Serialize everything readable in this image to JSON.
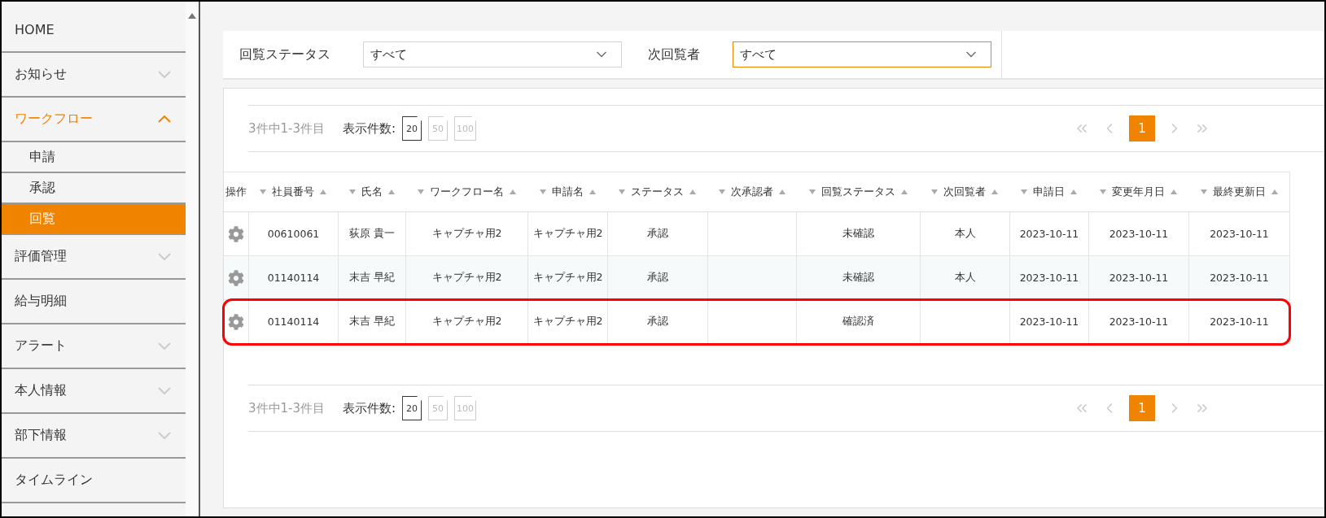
{
  "sidebar": {
    "items": [
      {
        "label": "HOME",
        "kind": "link",
        "selected": false
      },
      {
        "label": "お知らせ",
        "kind": "menu",
        "expanded": false,
        "selected": false
      },
      {
        "label": "ワークフロー",
        "kind": "menu",
        "expanded": true,
        "selected": false,
        "children": [
          {
            "label": "申請",
            "selected": false
          },
          {
            "label": "承認",
            "selected": false
          },
          {
            "label": "回覧",
            "selected": true
          }
        ]
      },
      {
        "label": "評価管理",
        "kind": "menu",
        "expanded": false,
        "selected": false
      },
      {
        "label": "給与明細",
        "kind": "link",
        "selected": false
      },
      {
        "label": "アラート",
        "kind": "menu",
        "expanded": false,
        "selected": false
      },
      {
        "label": "本人情報",
        "kind": "menu",
        "expanded": false,
        "selected": false
      },
      {
        "label": "部下情報",
        "kind": "menu",
        "expanded": false,
        "selected": false
      },
      {
        "label": "タイムライン",
        "kind": "link",
        "selected": false
      }
    ]
  },
  "filters": [
    {
      "label": "回覧ステータス",
      "value": "すべて",
      "focused": false
    },
    {
      "label": "次回覧者",
      "value": "すべて",
      "focused": true
    }
  ],
  "pager_top": {
    "summary": "3件中1-3件目",
    "page_size_label": "表示件数:",
    "page_sizes": [
      {
        "label": "20",
        "selected": true
      },
      {
        "label": "50",
        "selected": false
      },
      {
        "label": "100",
        "selected": false
      }
    ],
    "pages": [
      {
        "label": "1",
        "selected": true
      }
    ]
  },
  "table": {
    "columns": [
      {
        "label": "操作",
        "sortable": false
      },
      {
        "label": "社員番号",
        "sortable": true
      },
      {
        "label": "氏名",
        "sortable": true
      },
      {
        "label": "ワークフロー名",
        "sortable": true
      },
      {
        "label": "申請名",
        "sortable": true
      },
      {
        "label": "ステータス",
        "sortable": true
      },
      {
        "label": "次承認者",
        "sortable": true
      },
      {
        "label": "回覧ステータス",
        "sortable": true
      },
      {
        "label": "次回覧者",
        "sortable": true
      },
      {
        "label": "申請日",
        "sortable": true
      },
      {
        "label": "変更年月日",
        "sortable": true
      },
      {
        "label": "最終更新日",
        "sortable": true
      }
    ],
    "rows": [
      {
        "highlighted": false,
        "cells": [
          "",
          "00610061",
          "荻原 貴一",
          "キャプチャ用2",
          "キャプチャ用2",
          "承認",
          "",
          "未確認",
          "本人",
          "2023-10-11",
          "2023-10-11",
          "2023-10-11"
        ]
      },
      {
        "highlighted": false,
        "cells": [
          "",
          "01140114",
          "末吉 早紀",
          "キャプチャ用2",
          "キャプチャ用2",
          "承認",
          "",
          "未確認",
          "本人",
          "2023-10-11",
          "2023-10-11",
          "2023-10-11"
        ]
      },
      {
        "highlighted": true,
        "cells": [
          "",
          "01140114",
          "末吉 早紀",
          "キャプチャ用2",
          "キャプチャ用2",
          "承認",
          "",
          "確認済",
          "",
          "2023-10-11",
          "2023-10-11",
          "2023-10-11"
        ]
      }
    ]
  },
  "pager_bottom": {
    "summary": "3件中1-3件目",
    "page_size_label": "表示件数:",
    "page_sizes": [
      {
        "label": "20",
        "selected": true
      },
      {
        "label": "50",
        "selected": false
      },
      {
        "label": "100",
        "selected": false
      }
    ],
    "pages": [
      {
        "label": "1",
        "selected": true
      }
    ]
  }
}
